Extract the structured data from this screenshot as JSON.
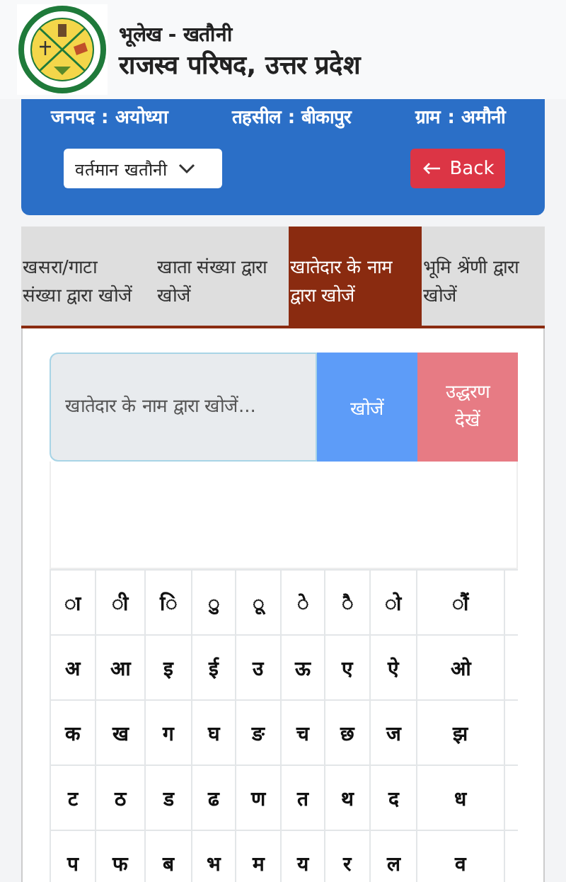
{
  "header": {
    "subtitle": "भूलेख - खतौनी",
    "title": "राजस्व परिषद, उत्तर प्रदेश"
  },
  "location": [
    "जनपद : अयोध्या",
    "तहसील : बीकापुर",
    "ग्राम : अमौनी"
  ],
  "dropdown": {
    "value": "वर्तमान खतौनी"
  },
  "back_button": {
    "label": "Back"
  },
  "tabs": [
    {
      "label": "खसरा/गाटा संख्या द्वारा खोजें",
      "selected": false
    },
    {
      "label": "खाता संख्या द्वारा खोजें",
      "selected": false
    },
    {
      "label": "खातेदार के नाम द्वारा खोजें",
      "selected": true
    },
    {
      "label": "भूमि श्रेंणी द्वारा खोजें",
      "selected": false
    }
  ],
  "search": {
    "placeholder": "खातेदार के नाम द्वारा खोजें...",
    "search_button": "खोजें",
    "extract_button": "उद्धरण देखें"
  },
  "keyboard": [
    [
      "ा",
      "ी",
      "ि",
      "ु",
      "ू",
      "े",
      "ै",
      "ो",
      "ौं"
    ],
    [
      "अ",
      "आ",
      "इ",
      "ई",
      "उ",
      "ऊ",
      "ए",
      "ऐ",
      "ओ"
    ],
    [
      "क",
      "ख",
      "ग",
      "घ",
      "ङ",
      "च",
      "छ",
      "ज",
      "झ"
    ],
    [
      "ट",
      "ठ",
      "ड",
      "ढ",
      "ण",
      "त",
      "थ",
      "द",
      "ध"
    ],
    [
      "प",
      "फ",
      "ब",
      "भ",
      "म",
      "य",
      "र",
      "ल",
      "व"
    ]
  ]
}
